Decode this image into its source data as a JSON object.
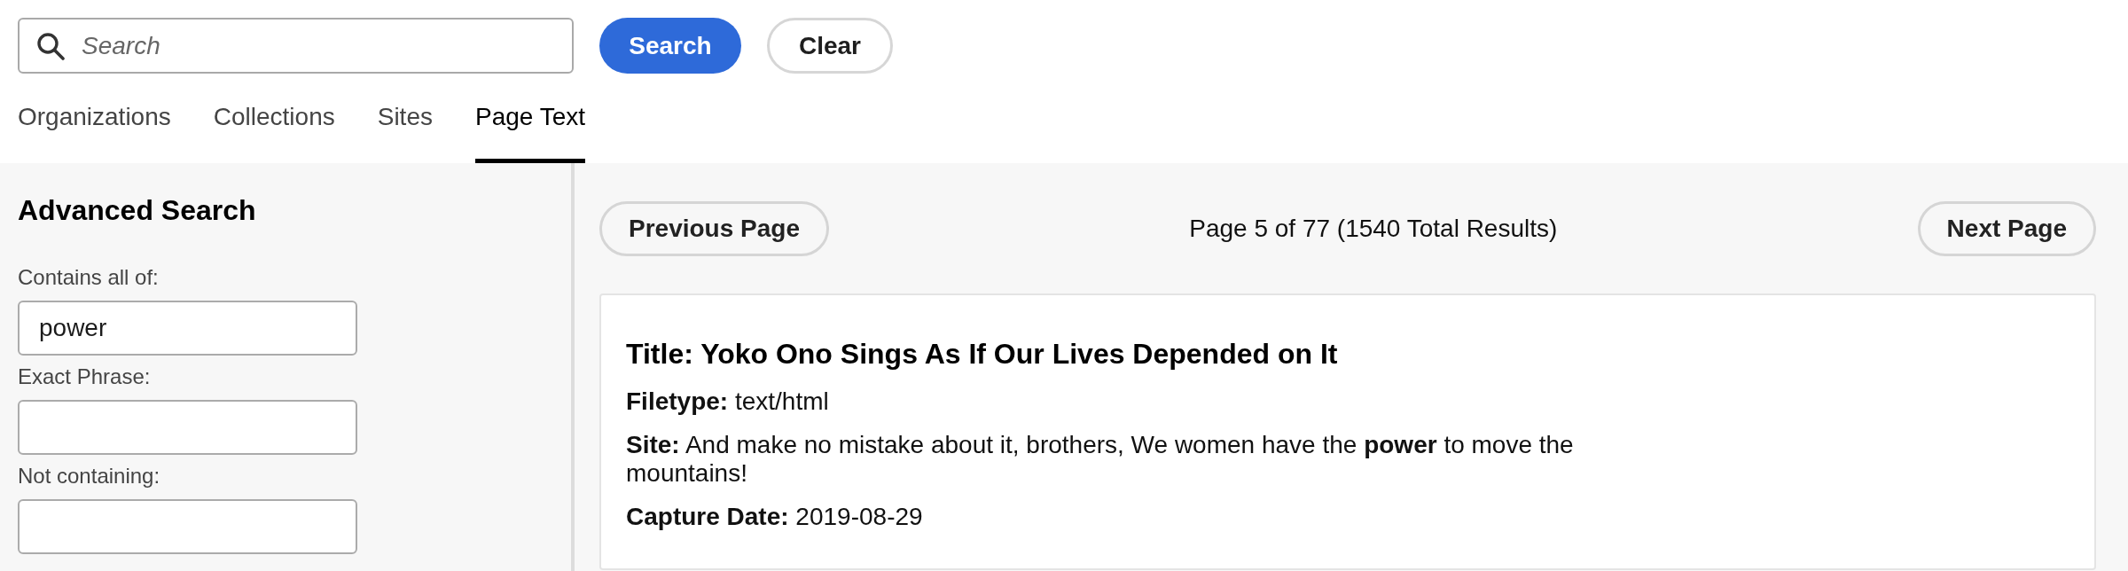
{
  "search": {
    "placeholder": "Search",
    "buttons": [
      {
        "label": "Search",
        "kind": "primary"
      },
      {
        "label": "Clear",
        "kind": "secondary"
      }
    ]
  },
  "tabs": [
    {
      "label": "Organizations",
      "selected": false
    },
    {
      "label": "Collections",
      "selected": false
    },
    {
      "label": "Sites",
      "selected": false
    },
    {
      "label": "Page Text",
      "selected": true
    }
  ],
  "advanced_search": {
    "title": "Advanced Search",
    "fields": [
      {
        "label": "Contains all of:",
        "value": "power"
      },
      {
        "label": "Exact Phrase:"
      },
      {
        "label": "Not containing:"
      }
    ]
  },
  "pagination": {
    "previous": "Previous Page",
    "summary": "Page 5 of 77 (1540 Total Results)",
    "next": "Next Page"
  },
  "results": [
    {
      "title": "Title: Yoko Ono Sings As If Our Lives Depended on It",
      "lines": [
        "**Filetype:** text/html",
        "**Site:** And make no mistake about it, brothers, We women have the **power** to move the mountains!",
        "**Capture Date:** 2019-08-29"
      ]
    }
  ]
}
